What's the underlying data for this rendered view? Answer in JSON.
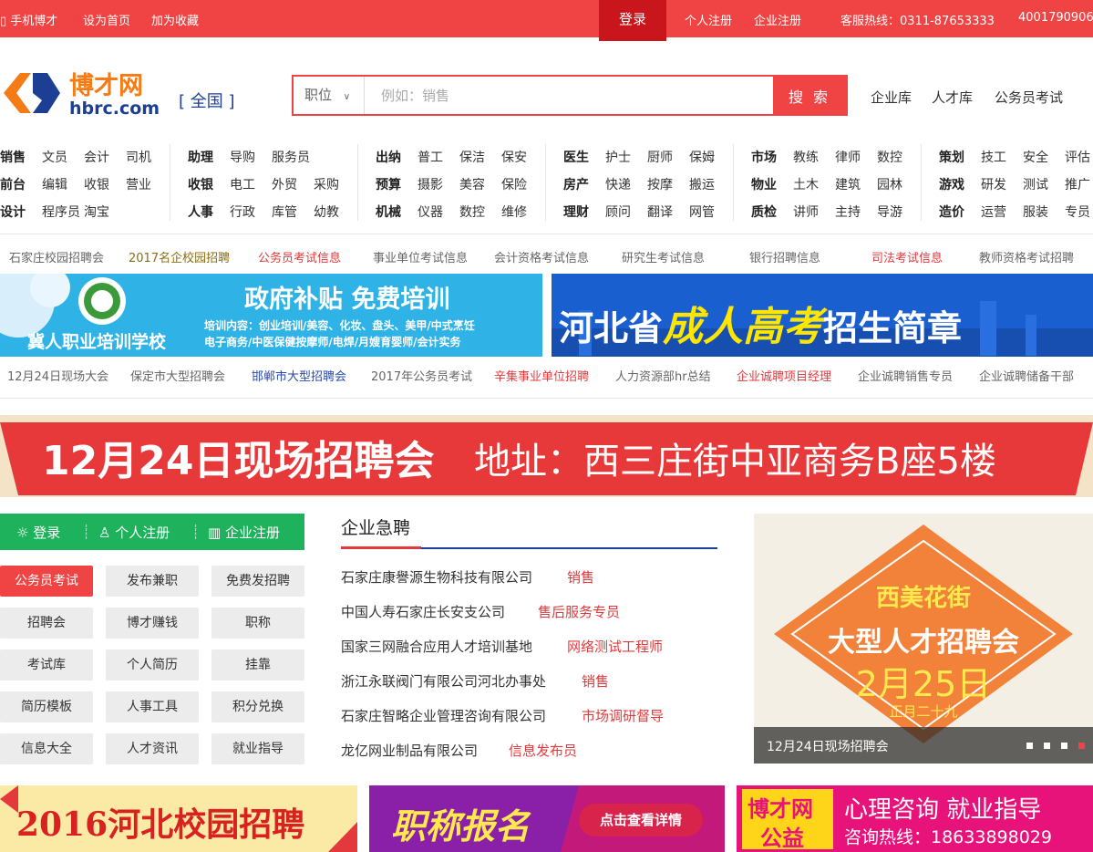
{
  "topbar": {
    "mobile": "手机博才",
    "set_home": "设为首页",
    "bookmark": "加为收藏",
    "login": "登录",
    "personal_register": "个人注册",
    "company_register": "企业注册",
    "hotline": "客服热线：0311-87653333",
    "hotline2": "4001790906"
  },
  "header": {
    "logo_cn": "博才网",
    "logo_en": "hbrc.com",
    "region": "[ 全国 ]",
    "search_category": "职位",
    "search_placeholder": "例如：销售",
    "search_button": "搜 索",
    "links": [
      "企业库",
      "人才库",
      "公务员考试"
    ]
  },
  "categories": [
    [
      [
        "销售",
        "文员",
        "会计",
        "司机"
      ],
      [
        "前台",
        "编辑",
        "收银",
        "营业"
      ],
      [
        "设计",
        "程序员",
        "淘宝"
      ]
    ],
    [
      [
        "助理",
        "导购",
        "服务员"
      ],
      [
        "收银",
        "电工",
        "外贸",
        "采购"
      ],
      [
        "人事",
        "行政",
        "库管",
        "幼教"
      ]
    ],
    [
      [
        "出纳",
        "普工",
        "保洁",
        "保安"
      ],
      [
        "预算",
        "摄影",
        "美容",
        "保险"
      ],
      [
        "机械",
        "仪器",
        "数控",
        "维修"
      ]
    ],
    [
      [
        "医生",
        "护士",
        "厨师",
        "保姆"
      ],
      [
        "房产",
        "快递",
        "按摩",
        "搬运"
      ],
      [
        "理财",
        "顾问",
        "翻译",
        "网管"
      ]
    ],
    [
      [
        "市场",
        "教练",
        "律师",
        "数控"
      ],
      [
        "物业",
        "土木",
        "建筑",
        "园林"
      ],
      [
        "质检",
        "讲师",
        "主持",
        "导游"
      ]
    ],
    [
      [
        "策划",
        "技工",
        "安全",
        "评估"
      ],
      [
        "游戏",
        "研发",
        "测试",
        "推广"
      ],
      [
        "造价",
        "运营",
        "服装",
        "专员"
      ]
    ]
  ],
  "quick_links_1": [
    "石家庄校园招聘会",
    "2017名企校园招聘",
    "公务员考试信息",
    "事业单位考试信息",
    "会计资格考试信息",
    "研究生考试信息",
    "银行招聘信息",
    "司法考试信息",
    "教师资格考试招聘"
  ],
  "banner1": {
    "title": "政府补贴  免费培训",
    "school": "冀人职业培训学校",
    "content_line1": "培训内容：创业培训/美容、化妆、盘头、美甲/中式烹饪",
    "content_line2": "电子商务/中医保健按摩师/电焊/月嫂育婴师/会计实务"
  },
  "banner2": {
    "part1": "河北省",
    "part2": "成人高考",
    "part3": "招生简章"
  },
  "quick_links_2": [
    "12月24日现场大会",
    "保定市大型招聘会",
    "邯郸市大型招聘会",
    "2017年公务员考试",
    "辛集事业单位招聘",
    "人力资源部hr总结",
    "企业诚聘项目经理",
    "企业诚聘销售专员",
    "企业诚聘储备干部"
  ],
  "big_banner": {
    "part1": "12月24日现场招聘会",
    "part2": "地址：西三庄街中亚商务B座5楼"
  },
  "account_bar": {
    "login": "登录",
    "personal": "个人注册",
    "company": "企业注册"
  },
  "quick_buttons": [
    [
      "公务员考试",
      "发布兼职",
      "免费发招聘"
    ],
    [
      "招聘会",
      "博才赚钱",
      "职称"
    ],
    [
      "考试库",
      "个人简历",
      "挂靠"
    ],
    [
      "简历模板",
      "人事工具",
      "积分兑换"
    ],
    [
      "信息大全",
      "人才资讯",
      "就业指导"
    ]
  ],
  "urgent": {
    "heading": "企业急聘",
    "jobs": [
      {
        "company": "石家庄康譽源生物科技有限公司",
        "position": "销售"
      },
      {
        "company": "中国人寿石家庄长安支公司",
        "position": "售后服务专员"
      },
      {
        "company": "国家三网融合应用人才培训基地",
        "position": "网络测试工程师"
      },
      {
        "company": "浙江永联阀门有限公司河北办事处",
        "position": "销售"
      },
      {
        "company": "石家庄智略企业管理咨询有限公司",
        "position": "市场调研督导"
      },
      {
        "company": "龙亿网业制品有限公司",
        "position": "信息发布员"
      }
    ]
  },
  "slider": {
    "line1": "西美花街",
    "line2": "大型人才招聘会",
    "date": "2月25日",
    "lunar": "正月二十九",
    "caption": "12月24日现场招聘会"
  },
  "bottom_banners": {
    "b1": "2016河北校园招聘",
    "b2_title": "职称报名",
    "b2_btn": "点击查看详情",
    "b3_brand1": "博才网",
    "b3_brand2": "公益",
    "b3_line1": "心理咨询  就业指导",
    "b3_line2": "咨询热线：18633898029"
  },
  "colors": {
    "brand_red": "#f04444",
    "green": "#1db25b",
    "orange": "#f57b17",
    "blue": "#1c3f94"
  }
}
